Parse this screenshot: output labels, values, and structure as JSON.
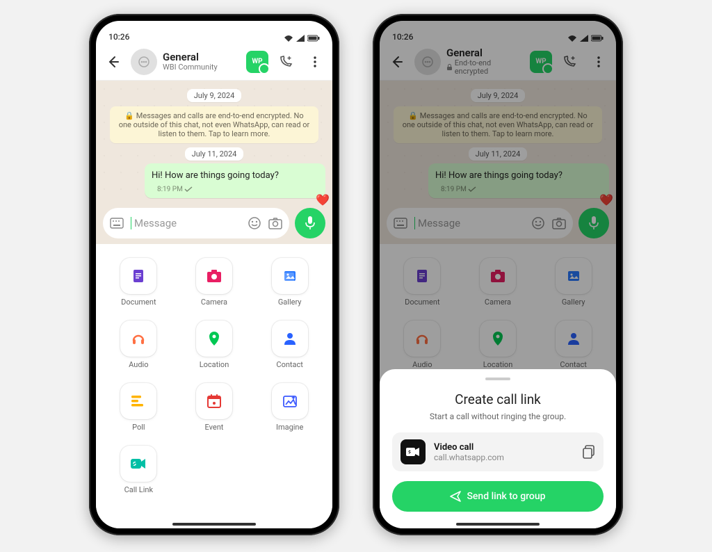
{
  "statusbar": {
    "time": "10:26"
  },
  "chat1": {
    "title": "General",
    "subtitle": "WBI Community"
  },
  "chat2": {
    "title": "General",
    "subtitle": "End-to-end encrypted"
  },
  "dates": {
    "d1": "July 9, 2024",
    "d2": "July 11, 2024"
  },
  "notice": "🔒 Messages and calls are end-to-end encrypted. No one outside of this chat, not even WhatsApp, can read or listen to them. Tap to learn more.",
  "message": {
    "text": "Hi! How are things going today?",
    "time": "8:19 PM"
  },
  "composer": {
    "placeholder": "Message"
  },
  "attachments": [
    {
      "iconColor": "#6b3fd1",
      "glyph": "doc",
      "label": "Document"
    },
    {
      "iconColor": "#e91e63",
      "glyph": "cam",
      "label": "Camera"
    },
    {
      "iconColor": "#2979ff",
      "glyph": "gal",
      "label": "Gallery"
    },
    {
      "iconColor": "#ff7043",
      "glyph": "aud",
      "label": "Audio"
    },
    {
      "iconColor": "#00c853",
      "glyph": "loc",
      "label": "Location"
    },
    {
      "iconColor": "#2962ff",
      "glyph": "con",
      "label": "Contact"
    },
    {
      "iconColor": "#ffb300",
      "glyph": "pol",
      "label": "Poll"
    },
    {
      "iconColor": "#e53935",
      "glyph": "evt",
      "label": "Event"
    },
    {
      "iconColor": "#3d5afe",
      "glyph": "img",
      "label": "Imagine"
    },
    {
      "iconColor": "#00bfa5",
      "glyph": "lnk",
      "label": "Call Link"
    }
  ],
  "sheet": {
    "title": "Create call link",
    "subtitle": "Start a call without ringing the group.",
    "link_type": "Video call",
    "link_url": "call.whatsapp.com",
    "cta": "Send link to group"
  }
}
